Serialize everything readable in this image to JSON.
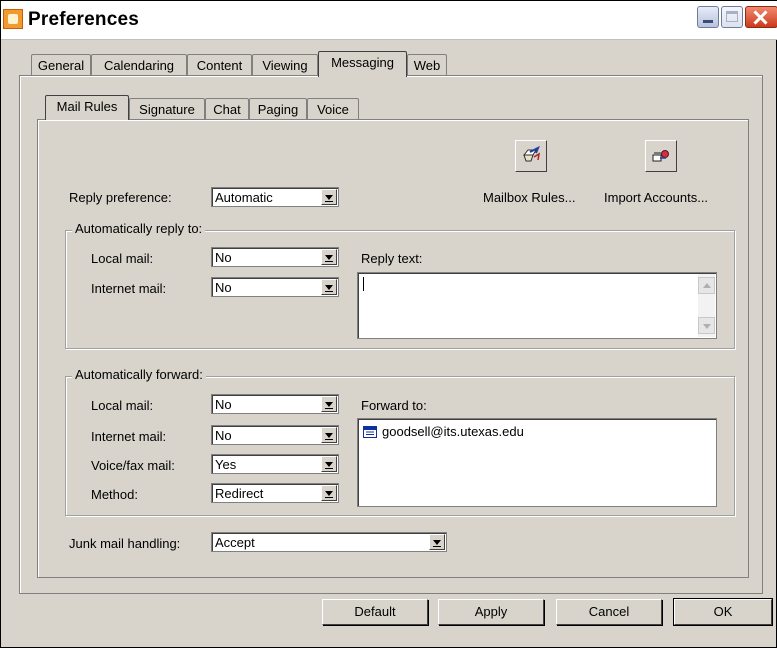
{
  "window": {
    "title": "Preferences"
  },
  "main_tabs": [
    "General",
    "Calendaring",
    "Content",
    "Viewing",
    "Messaging",
    "Web"
  ],
  "main_tab_active": "Messaging",
  "sub_tabs": [
    "Mail Rules",
    "Signature",
    "Chat",
    "Paging",
    "Voice"
  ],
  "sub_tab_active": "Mail Rules",
  "reply_preference": {
    "label": "Reply preference:",
    "value": "Automatic"
  },
  "toolbar": {
    "mailbox_rules_label": "Mailbox Rules...",
    "import_accounts_label": "Import Accounts..."
  },
  "auto_reply": {
    "title": "Automatically reply to:",
    "local_mail_label": "Local mail:",
    "local_mail_value": "No",
    "internet_mail_label": "Internet mail:",
    "internet_mail_value": "No",
    "reply_text_label": "Reply text:",
    "reply_text_value": ""
  },
  "auto_forward": {
    "title": "Automatically forward:",
    "local_mail_label": "Local mail:",
    "local_mail_value": "No",
    "internet_mail_label": "Internet mail:",
    "internet_mail_value": "No",
    "voicefax_label": "Voice/fax mail:",
    "voicefax_value": "Yes",
    "method_label": "Method:",
    "method_value": "Redirect",
    "forward_to_label": "Forward to:",
    "forward_to_entries": [
      "goodsell@its.utexas.edu"
    ]
  },
  "junk_mail": {
    "label": "Junk mail handling:",
    "value": "Accept"
  },
  "buttons": {
    "default_label": "Default",
    "apply_label": "Apply",
    "cancel_label": "Cancel",
    "ok_label": "OK"
  },
  "icons": {
    "app": "preferences-app-icon",
    "mailbox_rules": "mailbox-rules-icon",
    "import_accounts": "import-accounts-icon",
    "address_entry": "address-card-icon"
  },
  "colors": {
    "window_bg": "#d8d4cc",
    "close_button": "#d9492a",
    "title_text": "#000000"
  }
}
